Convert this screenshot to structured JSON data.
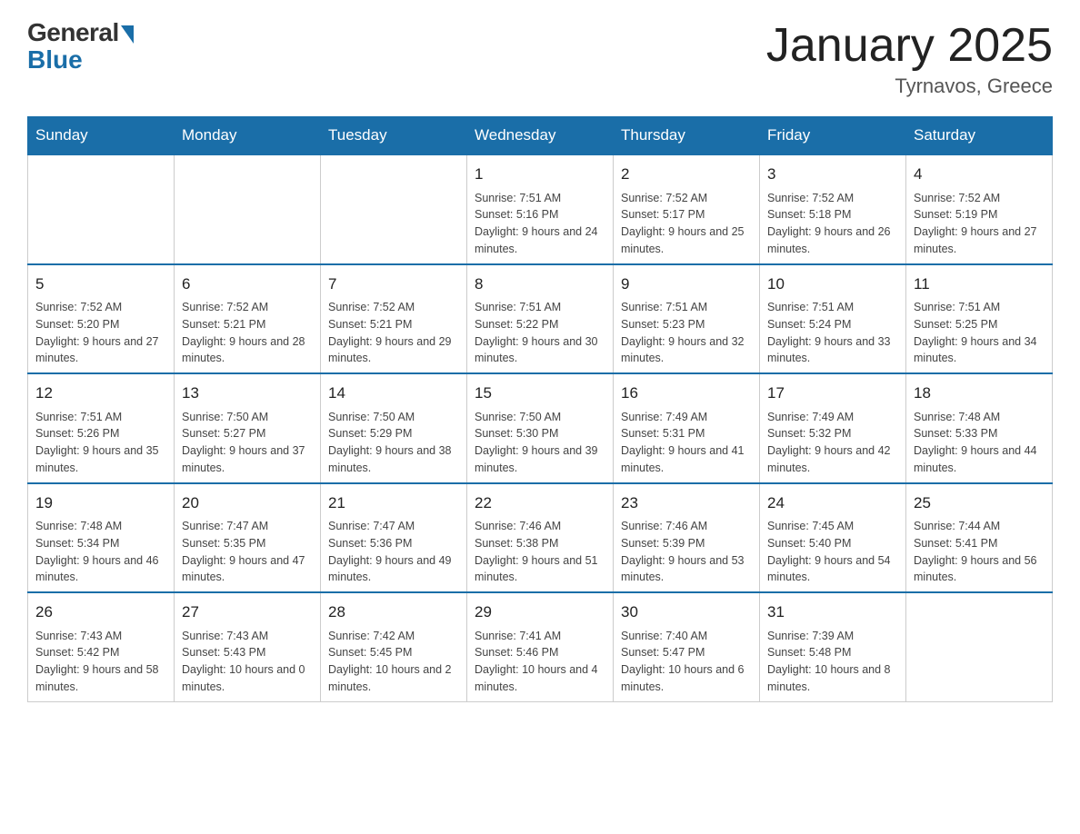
{
  "header": {
    "logo_general": "General",
    "logo_blue": "Blue",
    "title": "January 2025",
    "subtitle": "Tyrnavos, Greece"
  },
  "weekdays": [
    "Sunday",
    "Monday",
    "Tuesday",
    "Wednesday",
    "Thursday",
    "Friday",
    "Saturday"
  ],
  "weeks": [
    [
      {
        "day": "",
        "sunrise": "",
        "sunset": "",
        "daylight": ""
      },
      {
        "day": "",
        "sunrise": "",
        "sunset": "",
        "daylight": ""
      },
      {
        "day": "",
        "sunrise": "",
        "sunset": "",
        "daylight": ""
      },
      {
        "day": "1",
        "sunrise": "Sunrise: 7:51 AM",
        "sunset": "Sunset: 5:16 PM",
        "daylight": "Daylight: 9 hours and 24 minutes."
      },
      {
        "day": "2",
        "sunrise": "Sunrise: 7:52 AM",
        "sunset": "Sunset: 5:17 PM",
        "daylight": "Daylight: 9 hours and 25 minutes."
      },
      {
        "day": "3",
        "sunrise": "Sunrise: 7:52 AM",
        "sunset": "Sunset: 5:18 PM",
        "daylight": "Daylight: 9 hours and 26 minutes."
      },
      {
        "day": "4",
        "sunrise": "Sunrise: 7:52 AM",
        "sunset": "Sunset: 5:19 PM",
        "daylight": "Daylight: 9 hours and 27 minutes."
      }
    ],
    [
      {
        "day": "5",
        "sunrise": "Sunrise: 7:52 AM",
        "sunset": "Sunset: 5:20 PM",
        "daylight": "Daylight: 9 hours and 27 minutes."
      },
      {
        "day": "6",
        "sunrise": "Sunrise: 7:52 AM",
        "sunset": "Sunset: 5:21 PM",
        "daylight": "Daylight: 9 hours and 28 minutes."
      },
      {
        "day": "7",
        "sunrise": "Sunrise: 7:52 AM",
        "sunset": "Sunset: 5:21 PM",
        "daylight": "Daylight: 9 hours and 29 minutes."
      },
      {
        "day": "8",
        "sunrise": "Sunrise: 7:51 AM",
        "sunset": "Sunset: 5:22 PM",
        "daylight": "Daylight: 9 hours and 30 minutes."
      },
      {
        "day": "9",
        "sunrise": "Sunrise: 7:51 AM",
        "sunset": "Sunset: 5:23 PM",
        "daylight": "Daylight: 9 hours and 32 minutes."
      },
      {
        "day": "10",
        "sunrise": "Sunrise: 7:51 AM",
        "sunset": "Sunset: 5:24 PM",
        "daylight": "Daylight: 9 hours and 33 minutes."
      },
      {
        "day": "11",
        "sunrise": "Sunrise: 7:51 AM",
        "sunset": "Sunset: 5:25 PM",
        "daylight": "Daylight: 9 hours and 34 minutes."
      }
    ],
    [
      {
        "day": "12",
        "sunrise": "Sunrise: 7:51 AM",
        "sunset": "Sunset: 5:26 PM",
        "daylight": "Daylight: 9 hours and 35 minutes."
      },
      {
        "day": "13",
        "sunrise": "Sunrise: 7:50 AM",
        "sunset": "Sunset: 5:27 PM",
        "daylight": "Daylight: 9 hours and 37 minutes."
      },
      {
        "day": "14",
        "sunrise": "Sunrise: 7:50 AM",
        "sunset": "Sunset: 5:29 PM",
        "daylight": "Daylight: 9 hours and 38 minutes."
      },
      {
        "day": "15",
        "sunrise": "Sunrise: 7:50 AM",
        "sunset": "Sunset: 5:30 PM",
        "daylight": "Daylight: 9 hours and 39 minutes."
      },
      {
        "day": "16",
        "sunrise": "Sunrise: 7:49 AM",
        "sunset": "Sunset: 5:31 PM",
        "daylight": "Daylight: 9 hours and 41 minutes."
      },
      {
        "day": "17",
        "sunrise": "Sunrise: 7:49 AM",
        "sunset": "Sunset: 5:32 PM",
        "daylight": "Daylight: 9 hours and 42 minutes."
      },
      {
        "day": "18",
        "sunrise": "Sunrise: 7:48 AM",
        "sunset": "Sunset: 5:33 PM",
        "daylight": "Daylight: 9 hours and 44 minutes."
      }
    ],
    [
      {
        "day": "19",
        "sunrise": "Sunrise: 7:48 AM",
        "sunset": "Sunset: 5:34 PM",
        "daylight": "Daylight: 9 hours and 46 minutes."
      },
      {
        "day": "20",
        "sunrise": "Sunrise: 7:47 AM",
        "sunset": "Sunset: 5:35 PM",
        "daylight": "Daylight: 9 hours and 47 minutes."
      },
      {
        "day": "21",
        "sunrise": "Sunrise: 7:47 AM",
        "sunset": "Sunset: 5:36 PM",
        "daylight": "Daylight: 9 hours and 49 minutes."
      },
      {
        "day": "22",
        "sunrise": "Sunrise: 7:46 AM",
        "sunset": "Sunset: 5:38 PM",
        "daylight": "Daylight: 9 hours and 51 minutes."
      },
      {
        "day": "23",
        "sunrise": "Sunrise: 7:46 AM",
        "sunset": "Sunset: 5:39 PM",
        "daylight": "Daylight: 9 hours and 53 minutes."
      },
      {
        "day": "24",
        "sunrise": "Sunrise: 7:45 AM",
        "sunset": "Sunset: 5:40 PM",
        "daylight": "Daylight: 9 hours and 54 minutes."
      },
      {
        "day": "25",
        "sunrise": "Sunrise: 7:44 AM",
        "sunset": "Sunset: 5:41 PM",
        "daylight": "Daylight: 9 hours and 56 minutes."
      }
    ],
    [
      {
        "day": "26",
        "sunrise": "Sunrise: 7:43 AM",
        "sunset": "Sunset: 5:42 PM",
        "daylight": "Daylight: 9 hours and 58 minutes."
      },
      {
        "day": "27",
        "sunrise": "Sunrise: 7:43 AM",
        "sunset": "Sunset: 5:43 PM",
        "daylight": "Daylight: 10 hours and 0 minutes."
      },
      {
        "day": "28",
        "sunrise": "Sunrise: 7:42 AM",
        "sunset": "Sunset: 5:45 PM",
        "daylight": "Daylight: 10 hours and 2 minutes."
      },
      {
        "day": "29",
        "sunrise": "Sunrise: 7:41 AM",
        "sunset": "Sunset: 5:46 PM",
        "daylight": "Daylight: 10 hours and 4 minutes."
      },
      {
        "day": "30",
        "sunrise": "Sunrise: 7:40 AM",
        "sunset": "Sunset: 5:47 PM",
        "daylight": "Daylight: 10 hours and 6 minutes."
      },
      {
        "day": "31",
        "sunrise": "Sunrise: 7:39 AM",
        "sunset": "Sunset: 5:48 PM",
        "daylight": "Daylight: 10 hours and 8 minutes."
      },
      {
        "day": "",
        "sunrise": "",
        "sunset": "",
        "daylight": ""
      }
    ]
  ]
}
